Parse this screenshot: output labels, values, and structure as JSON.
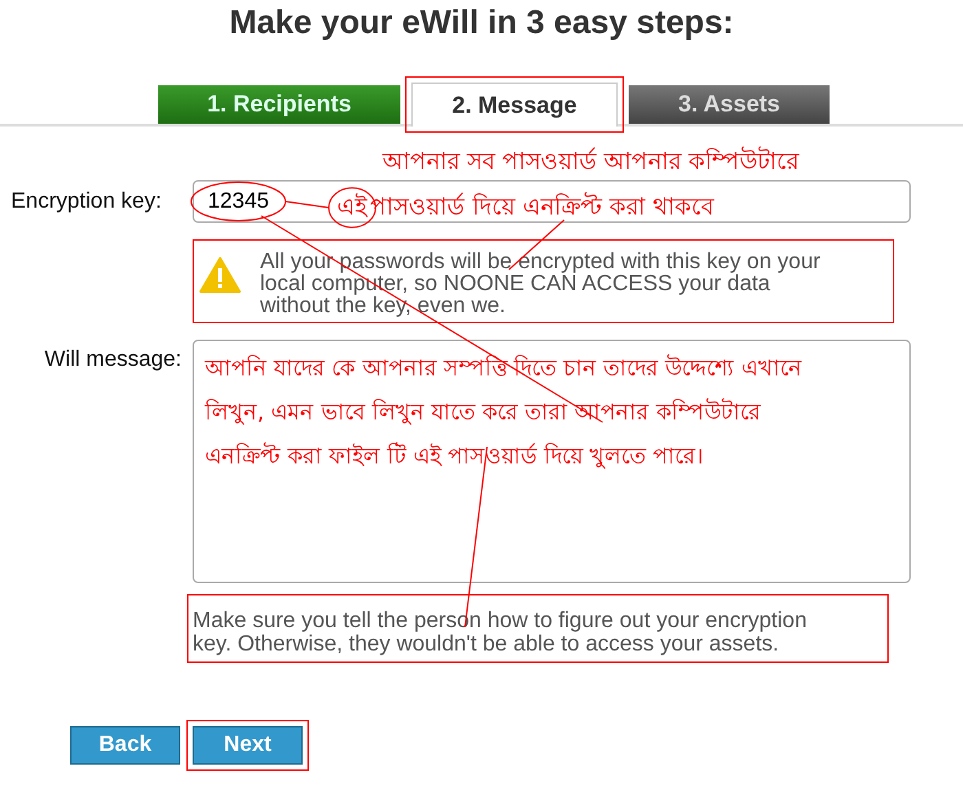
{
  "title": "Make your eWill in 3 easy steps:",
  "tabs": [
    {
      "label": "1. Recipients",
      "kind": "done",
      "selected": false
    },
    {
      "label": "2. Message",
      "kind": "current",
      "selected": true
    },
    {
      "label": "3. Assets",
      "kind": "upcoming",
      "selected": false
    }
  ],
  "encryption_key": {
    "label": "Encryption key:",
    "value": "12345"
  },
  "warning": "All your passwords will be encrypted with this key on your local computer, so NOONE CAN ACCESS your data without the key, even we.",
  "will_message": {
    "label": "Will message:",
    "value": "আপনি যাদের কে আপনার সম্পত্তি দিতে চান তাদের উদ্দেশ্যে এখানে লিখুন, এমন ভাবে লিখুন যাতে করে তারা আপনার কম্পিউটারে এনক্রিপ্ট করা ফাইল টি এই পাসওয়ার্ড দিয়ে খুলতে পারে।"
  },
  "hint": "Make sure you tell the person how to figure out your encryption key. Otherwise, they wouldn't be able to access your assets.",
  "buttons": [
    {
      "label": "Back"
    },
    {
      "label": "Next"
    }
  ],
  "annotation": {
    "line_1": "আপনার সব পাসওয়ার্ড আপনার কম্পিউটারে",
    "circled_word": "এই",
    "line_2_rest": "পাসওয়ার্ড দিয়ে এনক্রিপ্ট করা থাকবে"
  }
}
